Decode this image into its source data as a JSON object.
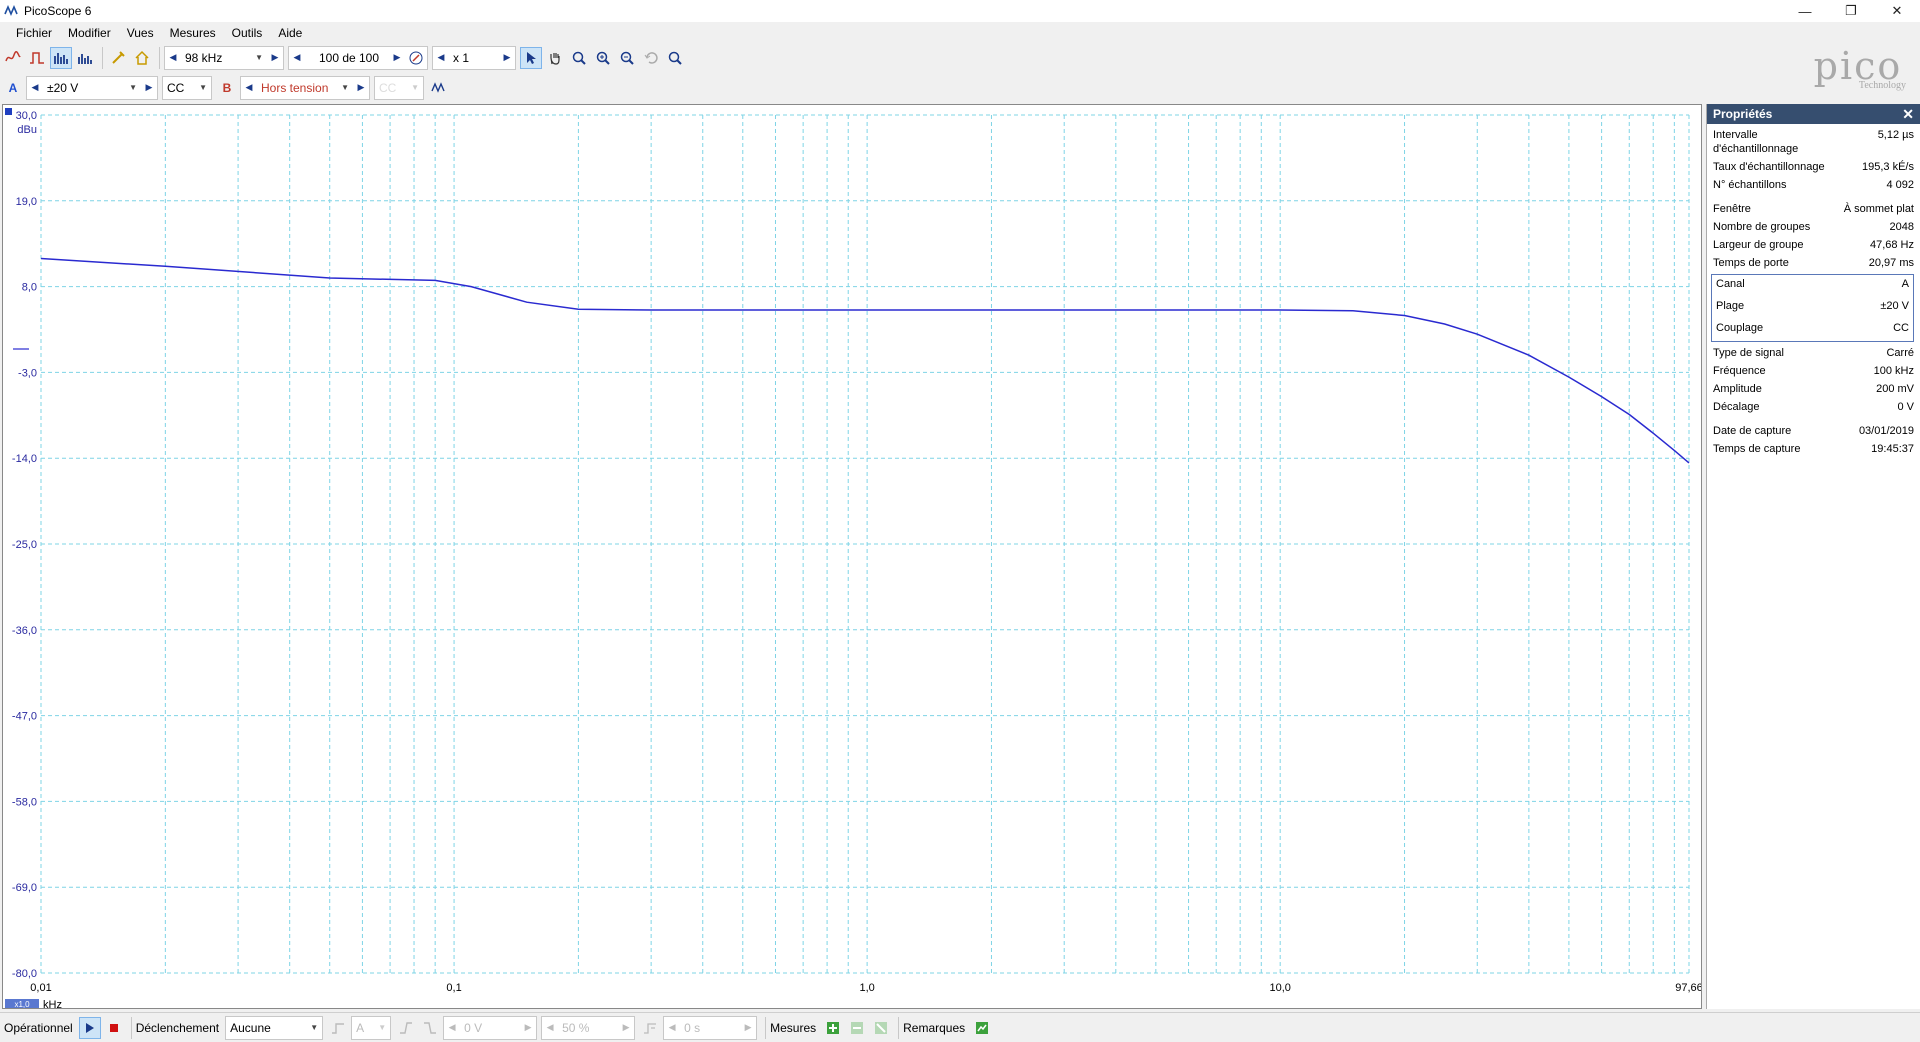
{
  "window": {
    "title": "PicoScope 6",
    "minimize": "—",
    "restore": "❐",
    "close": "✕"
  },
  "menu": [
    "Fichier",
    "Modifier",
    "Vues",
    "Mesures",
    "Outils",
    "Aide"
  ],
  "toolbar1": {
    "timebase": "98 kHz",
    "capture_count": "100 de 100",
    "zoom": "x 1"
  },
  "toolbar2": {
    "channel_a_label": "A",
    "channel_a_range": "±20 V",
    "channel_a_coupling": "CC",
    "channel_b_label": "B",
    "channel_b_state": "Hors tension",
    "channel_b_coupling": "CC"
  },
  "logo": {
    "brand": "pico",
    "sub": "Technology"
  },
  "properties": {
    "title": "Propriétés",
    "rows1": [
      {
        "k": "Intervalle d'échantillonnage",
        "v": "5,12 µs"
      },
      {
        "k": "Taux d'échantillonnage",
        "v": "195,3 kÉ/s"
      },
      {
        "k": "N° échantillons",
        "v": "4 092"
      }
    ],
    "rows2": [
      {
        "k": "Fenêtre",
        "v": "À sommet plat"
      },
      {
        "k": "Nombre de groupes",
        "v": "2048"
      },
      {
        "k": "Largeur de groupe",
        "v": "47,68 Hz"
      },
      {
        "k": "Temps de porte",
        "v": "20,97 ms"
      }
    ],
    "channel": [
      {
        "k": "Canal",
        "v": "A"
      },
      {
        "k": "Plage",
        "v": "±20 V"
      },
      {
        "k": "Couplage",
        "v": "CC"
      }
    ],
    "rows3": [
      {
        "k": "Type de signal",
        "v": "Carré"
      },
      {
        "k": "Fréquence",
        "v": "100 kHz"
      },
      {
        "k": "Amplitude",
        "v": "200 mV"
      },
      {
        "k": "Décalage",
        "v": "0 V"
      }
    ],
    "rows4": [
      {
        "k": "Date de capture",
        "v": "03/01/2019"
      },
      {
        "k": "Temps de capture",
        "v": "19:45:37"
      }
    ]
  },
  "status": {
    "mode": "Opérationnel",
    "trigger_label": "Déclenchement",
    "trigger_value": "Aucune",
    "trigger_channel": "A",
    "trigger_level": "0 V",
    "trigger_percent": "50 %",
    "trigger_delay": "0 s",
    "measures": "Mesures",
    "remarks": "Remarques"
  },
  "colors": {
    "trace": "#2a2ad0",
    "grid": "#7fd4e6",
    "axis_text": "#2a2aa0",
    "header": "#364e6f"
  },
  "chart_data": {
    "type": "line",
    "y_unit": "dBu",
    "x_unit": "kHz",
    "x_scale": "log",
    "ylim": [
      -80.0,
      30.0
    ],
    "xlim": [
      0.01,
      97.66
    ],
    "y_ticks": [
      "30,0",
      "19,0",
      "8,0",
      "-3,0",
      "-14,0",
      "-25,0",
      "-36,0",
      "-47,0",
      "-58,0",
      "-69,0",
      "-80,0"
    ],
    "x_ticks": [
      {
        "label": "0,01",
        "value": 0.01
      },
      {
        "label": "0,1",
        "value": 0.1
      },
      {
        "label": "1,0",
        "value": 1.0
      },
      {
        "label": "10,0",
        "value": 10.0
      },
      {
        "label": "97,66",
        "value": 97.66
      }
    ],
    "x_scale_badge": "x1,0",
    "grid": true,
    "series": [
      {
        "x": [
          0.01,
          0.02,
          0.05,
          0.09,
          0.11,
          0.15,
          0.2,
          0.3,
          0.5,
          1.0,
          2.0,
          5.0,
          10.0,
          15.0,
          20.0,
          25.0,
          30.0,
          40.0,
          50.0,
          60.0,
          70.0,
          80.0,
          90.0,
          97.66
        ],
        "y": [
          11.6,
          10.6,
          9.1,
          8.8,
          8.0,
          6.0,
          5.1,
          5.0,
          5.0,
          5.0,
          5.0,
          5.0,
          5.0,
          4.9,
          4.3,
          3.2,
          1.9,
          -0.8,
          -3.6,
          -6.1,
          -8.4,
          -10.8,
          -13.0,
          -14.6
        ]
      }
    ]
  }
}
